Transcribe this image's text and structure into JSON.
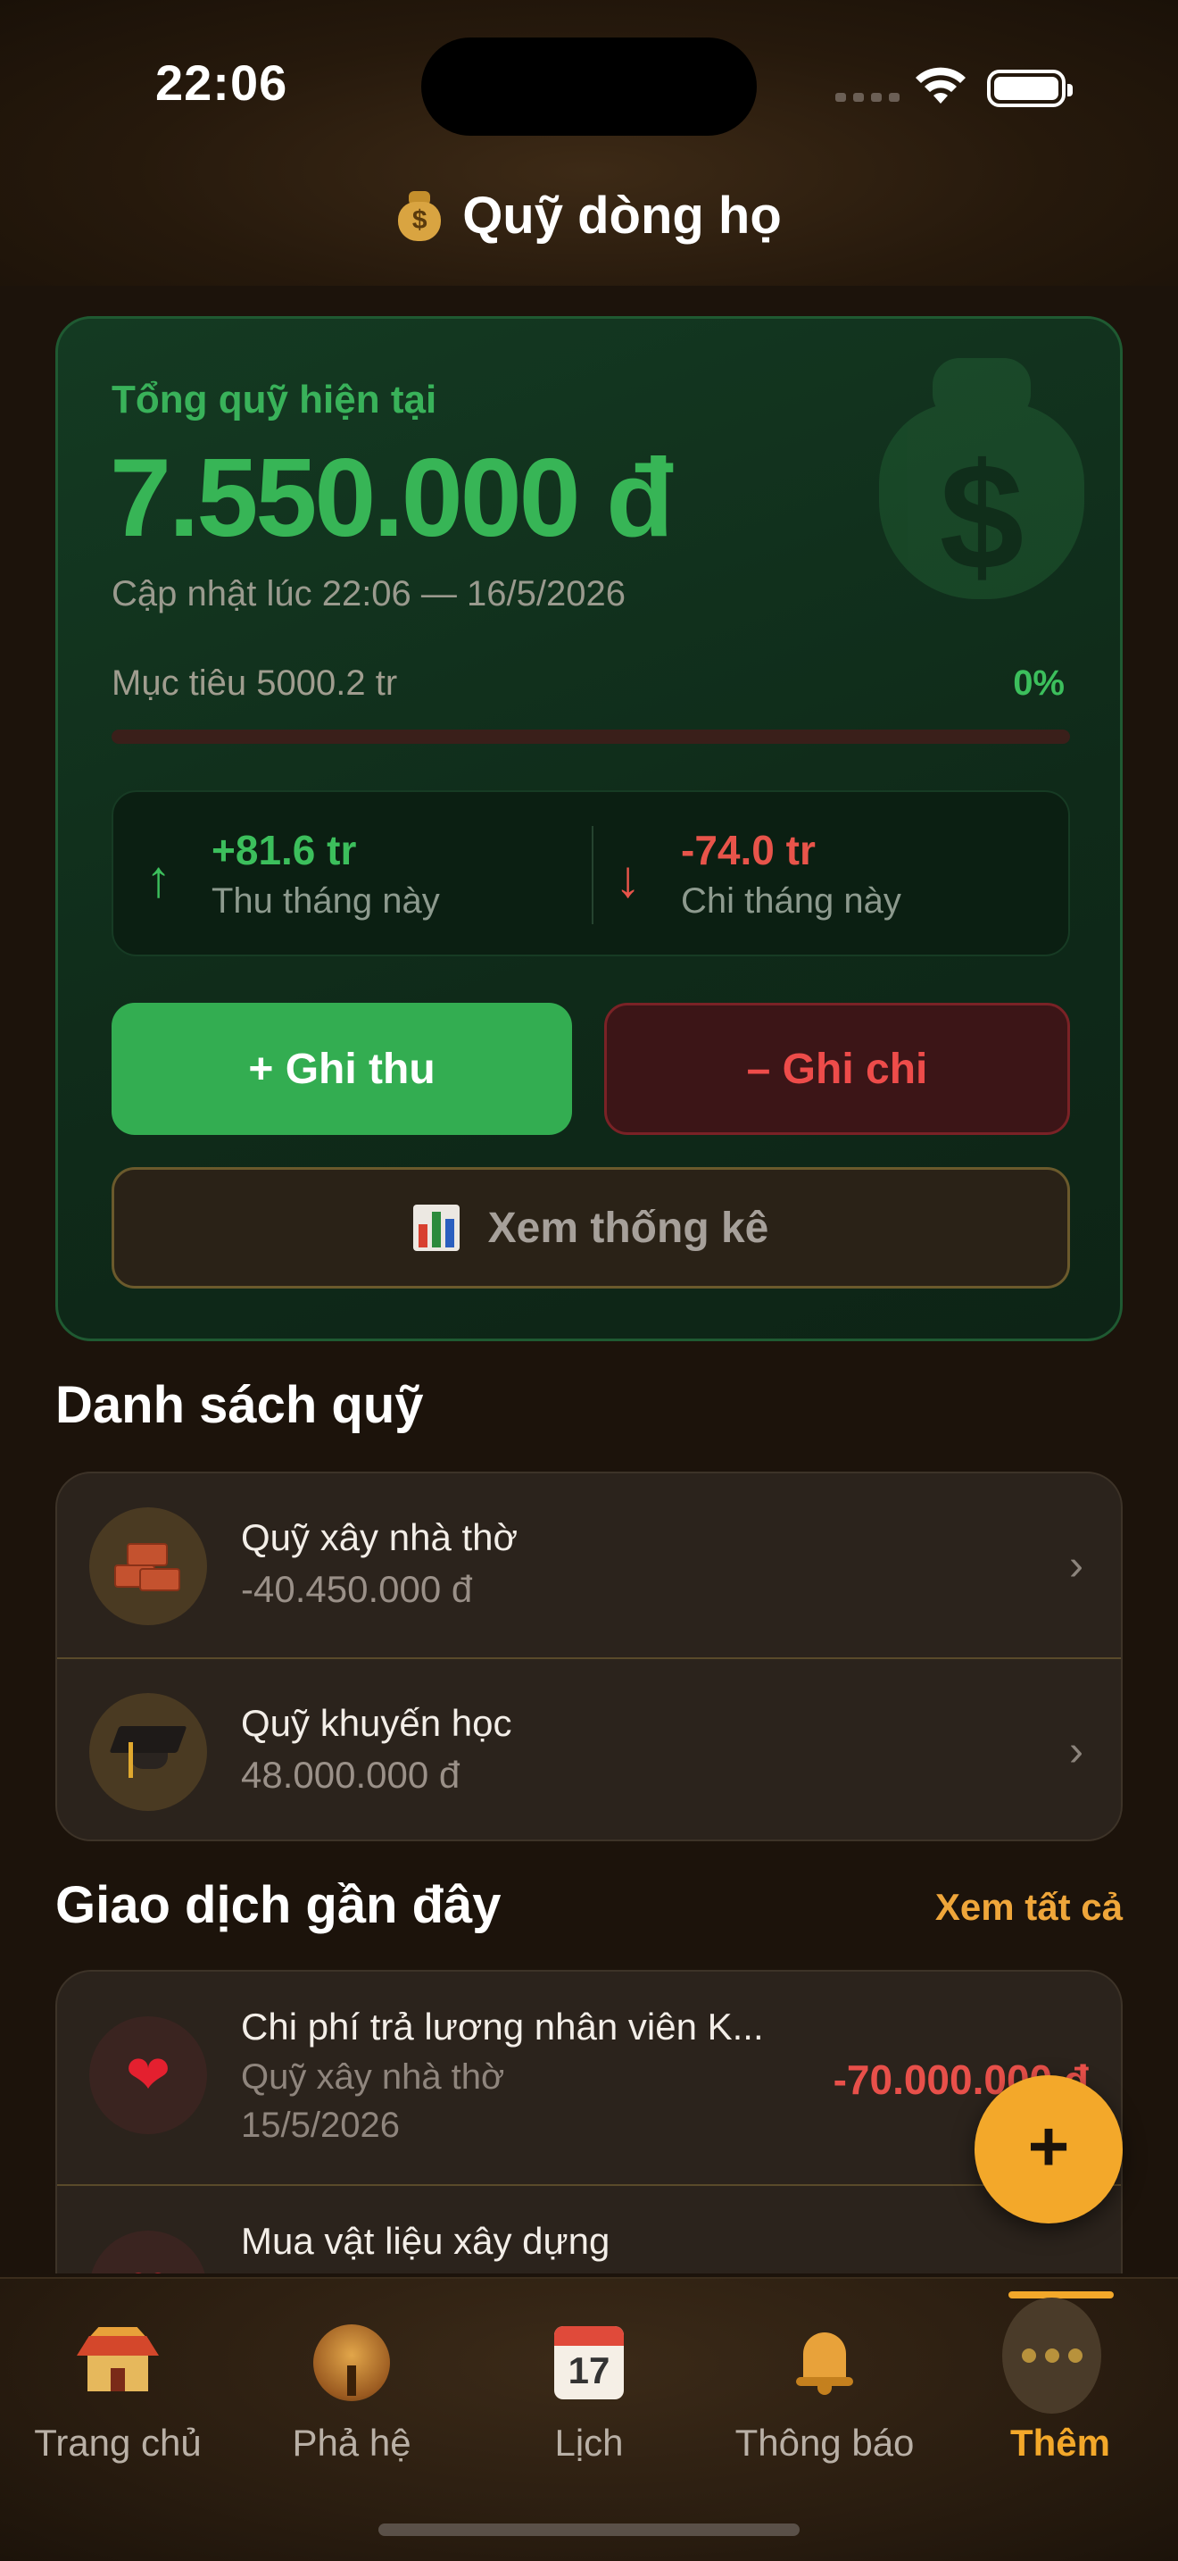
{
  "status_bar": {
    "time": "22:06"
  },
  "header": {
    "icon": "money-bag-icon",
    "title": "Quỹ dòng họ"
  },
  "fund_card": {
    "label": "Tổng quỹ hiện tại",
    "total": "7.550.000 đ",
    "updated": "Cập nhật lúc 22:06 — 16/5/2026",
    "goal_label": "Mục tiêu 5000.2 tr",
    "goal_percent": "0%",
    "progress_fraction": 0.0,
    "income_value": "+81.6 tr",
    "income_caption": "Thu tháng này",
    "expense_value": "-74.0 tr",
    "expense_caption": "Chi tháng này",
    "add_income_label": "+ Ghi thu",
    "add_expense_label": "– Ghi chi",
    "stats_label": "Xem thống kê"
  },
  "fund_list": {
    "title": "Danh sách quỹ",
    "items": [
      {
        "name": "Quỹ xây nhà thờ",
        "amount": "-40.450.000 đ",
        "icon": "bricks-icon"
      },
      {
        "name": "Quỹ khuyến học",
        "amount": "48.000.000 đ",
        "icon": "graduation-cap-icon"
      }
    ]
  },
  "transactions": {
    "title": "Giao dịch gần đây",
    "see_all": "Xem tất cả",
    "items": [
      {
        "name": "Chi phí trả lương nhân viên K...",
        "fund": "Quỹ xây nhà thờ",
        "date": "15/5/2026",
        "amount": "-70.000.000 đ",
        "icon": "heart-icon"
      },
      {
        "name": "Mua vật liệu xây dựng",
        "fund": "",
        "date": "",
        "amount": "",
        "icon": "heart-icon"
      }
    ]
  },
  "fab": {
    "label": "+"
  },
  "tabbar": {
    "items": [
      {
        "label": "Trang chủ",
        "icon": "temple-icon"
      },
      {
        "label": "Phả hệ",
        "icon": "tree-icon"
      },
      {
        "label": "Lịch",
        "icon": "calendar-icon",
        "badge": "17"
      },
      {
        "label": "Thông báo",
        "icon": "bell-icon"
      },
      {
        "label": "Thêm",
        "icon": "more-icon",
        "active": true
      }
    ]
  },
  "colors": {
    "accent": "#f3a82a",
    "income": "#37b556",
    "expense": "#e8504a",
    "background": "#1c130b"
  }
}
